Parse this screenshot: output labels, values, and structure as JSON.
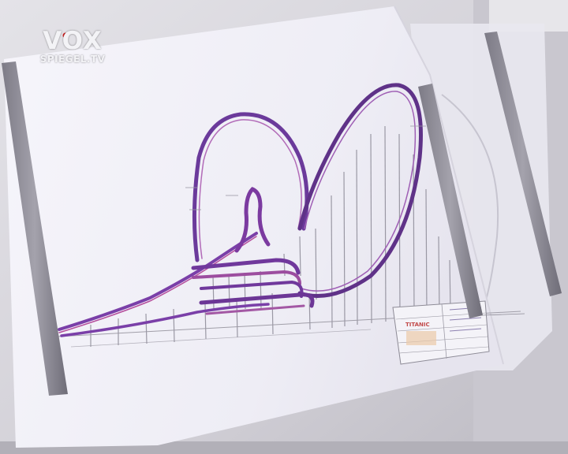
{
  "overlay": {
    "channel_logo": "VOX",
    "program_logo": "SPIEGEL.TV"
  },
  "drawing": {
    "subject": "roller-coaster-track-blueprint",
    "title_block_name": "TITANIC"
  },
  "colors": {
    "paper": "#f1f0f7",
    "background": "#d8d6dd",
    "track_purple": "#7a3fa8",
    "track_magenta": "#b54d9c",
    "support_gray": "#9a98a4",
    "rail_gray": "#8c8a94",
    "title_red": "#c24a4a"
  },
  "icons": {
    "logo_dot": "red-dot-icon"
  }
}
